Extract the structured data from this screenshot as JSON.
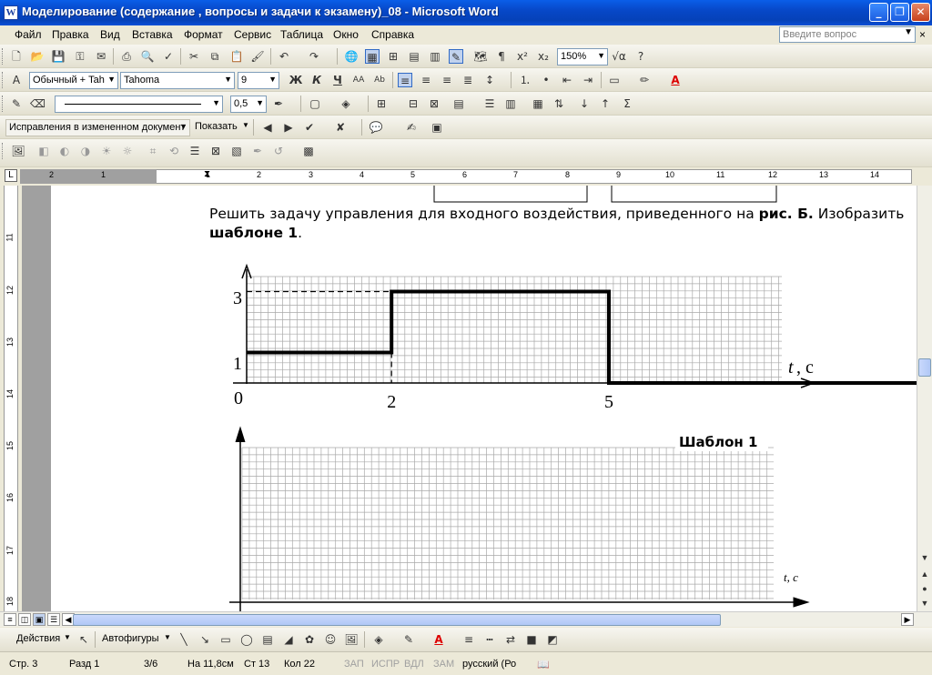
{
  "window": {
    "title": "Моделирование (содержание , вопросы и задачи к экзамену)_08 - Microsoft Word",
    "app_icon_letter": "W",
    "minimize_glyph": "_",
    "maximize_glyph": "❐",
    "close_glyph": "✕"
  },
  "menu": {
    "items": [
      "Файл",
      "Правка",
      "Вид",
      "Вставка",
      "Формат",
      "Сервис",
      "Таблица",
      "Окно",
      "Справка"
    ],
    "help_placeholder": "Введите вопрос",
    "close_glyph": "×"
  },
  "toolbar_standard": {
    "zoom": "150%"
  },
  "toolbar_format": {
    "style": "Обычный + Tah",
    "font": "Tahoma",
    "size": "9",
    "bold": "Ж",
    "italic": "К",
    "underline": "Ч"
  },
  "toolbar_drawing_lines": {
    "line_width": "0,5"
  },
  "toolbar_review": {
    "display_mode": "Исправления в измененном документ",
    "show_label": "Показать"
  },
  "ruler": {
    "h_numbers": [
      "2",
      "1",
      "1",
      "2",
      "3",
      "4",
      "5",
      "6",
      "7",
      "8",
      "9",
      "10",
      "11",
      "12",
      "13",
      "14"
    ],
    "v_numbers": [
      "11",
      "12",
      "13",
      "14",
      "15",
      "16",
      "17",
      "18"
    ],
    "corner_glyph": "L"
  },
  "document": {
    "paragraph": {
      "part1": "Решить задачу управления для входного воздействия, приведенного на ",
      "bold1": "рис. Б.",
      "part2": " Изобразить",
      "line2_bold": "шаблоне 1",
      "line2_end": "."
    },
    "chart_labels": {
      "y_top": "3",
      "y_low": "1",
      "origin": "0",
      "x_2": "2",
      "x_5": "5",
      "axis_t": "t",
      "axis_unit": ", с",
      "template_title": "Шаблон 1",
      "template_axis": "t, с"
    }
  },
  "chart_data": {
    "type": "line",
    "series": [
      {
        "x": [
          0,
          2,
          2,
          5,
          5,
          9.5
        ],
        "y": [
          1,
          1,
          3,
          3,
          0,
          0
        ]
      }
    ],
    "x_ticks": [
      "0",
      "2",
      "5"
    ],
    "y_ticks": [
      "1",
      "3"
    ],
    "xlabel": "t, с",
    "ylabel": "",
    "xlim": [
      0,
      9.5
    ],
    "ylim": [
      0,
      3.6
    ],
    "grid": true
  },
  "drawing_toolbar": {
    "actions": "Действия",
    "autoshapes": "Автофигуры"
  },
  "status": {
    "page": "Стр. 3",
    "section": "Разд 1",
    "pages": "3/6",
    "at": "На 11,8см",
    "line": "Ст 13",
    "col": "Кол 22",
    "rec": "ЗАП",
    "trk": "ИСПР",
    "ext": "ВДЛ",
    "ovr": "ЗАМ",
    "lang": "русский (Ро"
  },
  "colors": {
    "titlebar": "#0a5ee8",
    "page_gray": "#a0a0a0",
    "grid": "#a9a9a9"
  }
}
